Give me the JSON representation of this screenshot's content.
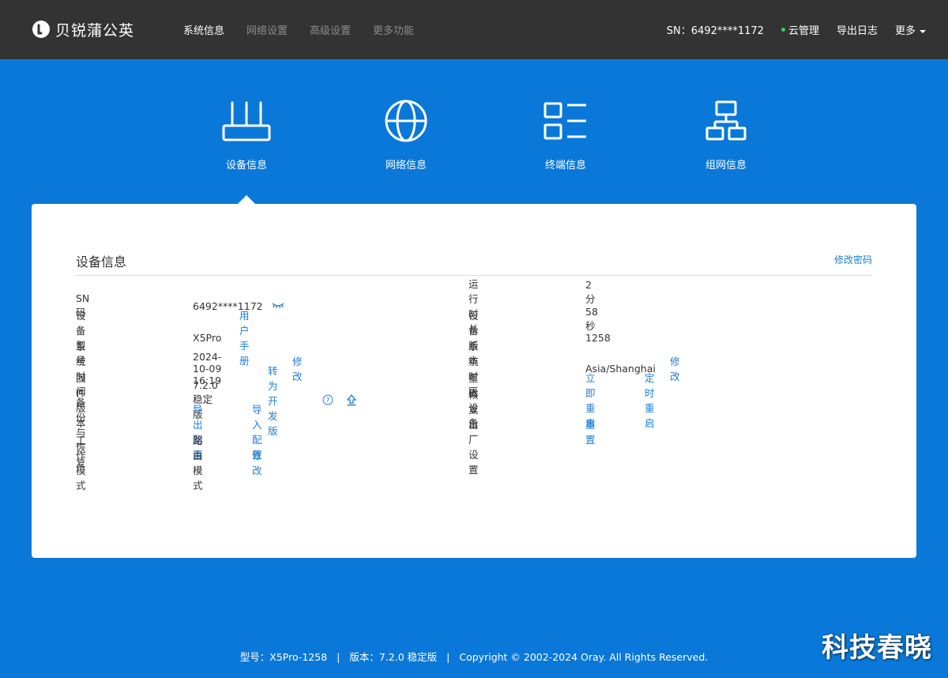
{
  "header": {
    "logo_text": "贝锐蒲公英",
    "nav": [
      "系统信息",
      "网络设置",
      "高级设置",
      "更多功能"
    ],
    "sn_label": "SN：6492****1172",
    "cloud_label": "云管理",
    "export_log_label": "导出日志",
    "more_label": "更多"
  },
  "categories": [
    {
      "label": "设备信息",
      "icon": "router-icon"
    },
    {
      "label": "网络信息",
      "icon": "globe-icon"
    },
    {
      "label": "终端信息",
      "icon": "list-icon"
    },
    {
      "label": "组网信息",
      "icon": "network-topology-icon"
    }
  ],
  "card": {
    "title": "设备信息",
    "change_password": "修改密码",
    "left": {
      "sn": {
        "label": "SN码",
        "value": "6492****1172"
      },
      "model": {
        "label": "设备型号",
        "value": "X5Pro",
        "link": "用户手册"
      },
      "time": {
        "label": "系统时间",
        "value": "2024-10-09 16:19",
        "link": "修改"
      },
      "firmware": {
        "label": "固件版本",
        "value": "7.2.0 稳定版",
        "link": "转为开发版"
      },
      "backup": {
        "label": "备份与恢复",
        "link1": "导出配置",
        "link2": "导入配置"
      },
      "mode": {
        "label": "工作模式",
        "value": "路由模式",
        "link": "修改"
      }
    },
    "right": {
      "uptime": {
        "label": "运行时长",
        "value": "2分 58秒"
      },
      "hw_version": {
        "label": "设备版本",
        "value": "1258"
      },
      "timezone": {
        "label": "系统时区",
        "value": "Asia/Shanghai",
        "link": "修改"
      },
      "reboot": {
        "label": "重启设备",
        "link1": "立即重启",
        "link2": "定时重启"
      },
      "factory": {
        "label": "恢复出厂设置",
        "link": "重置"
      }
    }
  },
  "footer": {
    "model": "型号：X5Pro-1258",
    "version": "版本：7.2.0 稳定版",
    "copyright": "Copyright © 2002-2024 Oray. All Rights Reserved."
  },
  "watermark": "科技春晓",
  "colors": {
    "background": "#0a78d8",
    "topbar": "#333333",
    "link": "#1b7ed6"
  }
}
